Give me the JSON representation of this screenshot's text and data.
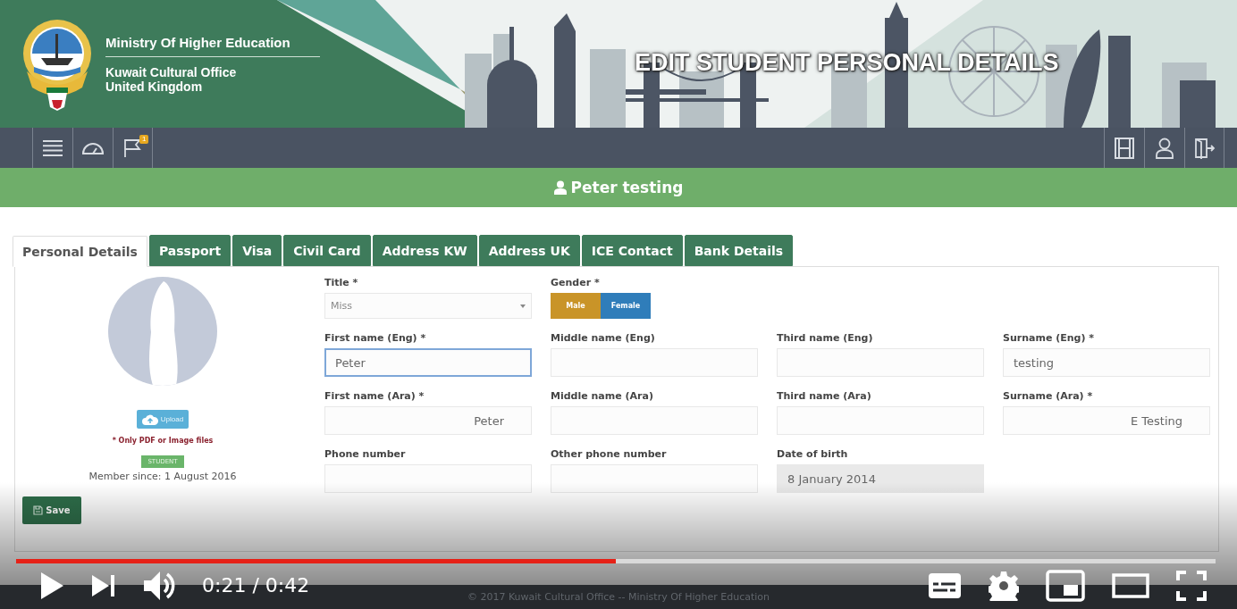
{
  "header": {
    "ministry": "Ministry Of Higher Education",
    "office_lines": [
      "Kuwait Cultural Office",
      "United Kingdom"
    ],
    "page_title": "EDIT STUDENT PERSONAL DETAILS"
  },
  "nav": {
    "flag_badge": "1"
  },
  "user_bar": {
    "name": "Peter testing"
  },
  "tabs": [
    {
      "label": "Personal Details",
      "selected": true
    },
    {
      "label": "Passport",
      "selected": false
    },
    {
      "label": "Visa",
      "selected": false
    },
    {
      "label": "Civil Card",
      "selected": false
    },
    {
      "label": "Address KW",
      "selected": false
    },
    {
      "label": "Address UK",
      "selected": false
    },
    {
      "label": "ICE Contact",
      "selected": false
    },
    {
      "label": "Bank Details",
      "selected": false
    }
  ],
  "profile": {
    "upload": "Upload",
    "note": "* Only PDF or Image files",
    "role_badge": "STUDENT",
    "member_since": "Member since: 1 August 2016",
    "save": "Save"
  },
  "form": {
    "rows": [
      [
        {
          "kind": "select",
          "label": "Title *",
          "value": "Miss"
        },
        {
          "kind": "toggle",
          "label": "Gender *",
          "options": [
            {
              "label": "Male",
              "selected": true
            },
            {
              "label": "Female",
              "selected": false
            }
          ]
        }
      ],
      [
        {
          "kind": "text",
          "label": "First name (Eng) *",
          "value": "Peter",
          "focused": true
        },
        {
          "kind": "text",
          "label": "Middle name (Eng)",
          "focused": false
        },
        {
          "kind": "text",
          "label": "Third name (Eng)",
          "focused": false
        },
        {
          "kind": "text",
          "label": "Surname (Eng) *",
          "value": "testing",
          "focused": false
        }
      ],
      [
        {
          "kind": "text",
          "label": "First name (Ara) *",
          "value": "Peter",
          "rtl": true,
          "focused": false
        },
        {
          "kind": "text",
          "label": "Middle name (Ara)",
          "focused": false
        },
        {
          "kind": "text",
          "label": "Third name (Ara)",
          "focused": false
        },
        {
          "kind": "text",
          "label": "Surname (Ara) *",
          "value": "E Testing",
          "rtl": true,
          "focused": false
        }
      ],
      [
        {
          "kind": "text",
          "label": "Phone number",
          "focused": false
        },
        {
          "kind": "text",
          "label": "Other phone number",
          "focused": false
        },
        {
          "kind": "date",
          "label": "Date of birth",
          "value": "8 January 2014",
          "disabled": true
        }
      ]
    ]
  },
  "footer": {
    "copyright": "© 2017 Kuwait Cultural Office -- Ministry Of Higher Education"
  },
  "video": {
    "progress": {
      "level": 0.5
    },
    "time": "0:21 / 0:42"
  }
}
